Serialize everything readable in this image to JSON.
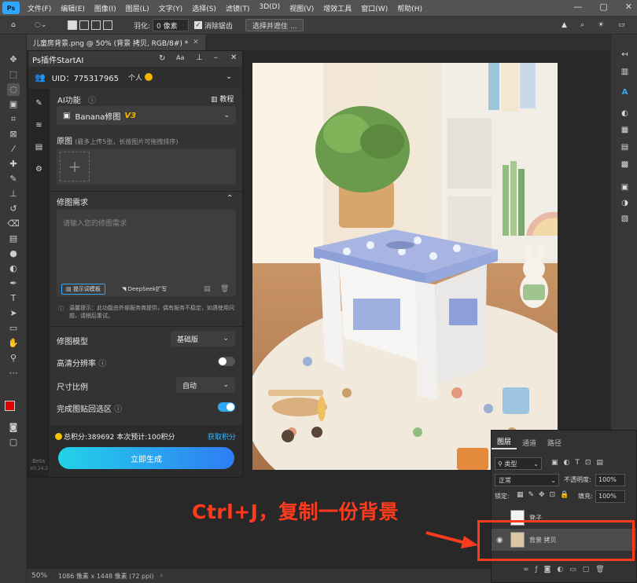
{
  "menubar": {
    "app_badge": "Ps",
    "items": [
      "文件(F)",
      "编辑(E)",
      "图像(I)",
      "图层(L)",
      "文字(Y)",
      "选择(S)",
      "滤镜(T)",
      "3D(D)",
      "视图(V)",
      "增效工具",
      "窗口(W)",
      "帮助(H)"
    ]
  },
  "options": {
    "feather_label": "羽化:",
    "feather_value": "0 像素",
    "antialias_label": "消除锯齿",
    "select_mask_button": "选择并遮住 ..."
  },
  "document": {
    "tab_title": "儿童房背景.png @ 50% (背景 拷贝, RGB/8#) *"
  },
  "status": {
    "zoom": "50%",
    "info": "1086 像素 x 1448 像素 (72 ppi)"
  },
  "plugin": {
    "title": "Ps插件StartAI",
    "uid_label": "UID：775317965",
    "user_type": "个人",
    "ai_function_label": "AI功能",
    "tutorial_label": "教程",
    "model_select": "Banana修图",
    "model_version": "V3",
    "source_label": "原图",
    "source_hint": "(最多上传5张，长按图片可拖拽排序)",
    "requirement_label": "修图需求",
    "requirement_placeholder": "请输入您的修图需求",
    "prompt_template_btn": "提示词模板",
    "deepseek_btn": "DeepSeek扩写",
    "notice": "温馨提示：此功能由外部服务商提供，偶有服务不稳定，如遇使用问题，请稍后重试。",
    "model_label": "修图模型",
    "model_value": "基础版",
    "hires_label": "高清分辨率",
    "ratio_label": "尺寸比例",
    "ratio_value": "自动",
    "paste_back_label": "完成图贴回选区",
    "points_text": "总积分:389692  本次预计:100积分",
    "get_points": "获取积分",
    "generate_btn": "立即生成",
    "beta_label": "Beta",
    "version": "V0.24.2",
    "hires_on": false,
    "paste_back_on": true
  },
  "layers": {
    "tabs": [
      "图层",
      "通道",
      "路径"
    ],
    "filter_label": "类型",
    "blend_mode": "正常",
    "opacity_label": "不透明度:",
    "opacity_value": "100%",
    "lock_label": "锁定:",
    "fill_label": "填充:",
    "fill_value": "100%",
    "rows": [
      {
        "name": "凳子"
      },
      {
        "name": "背景 拷贝"
      }
    ]
  },
  "annotation": {
    "text": "Ctrl+J，复制一份背景"
  },
  "colors": {
    "accent": "#31a8ff",
    "annotation": "#ff3b1d",
    "generate_gradient_start": "#22d3e8",
    "generate_gradient_end": "#2f7cf6",
    "toggle_on": "#2ea8f5",
    "points_link": "#39b7ff",
    "version_badge": "#f5b400"
  }
}
